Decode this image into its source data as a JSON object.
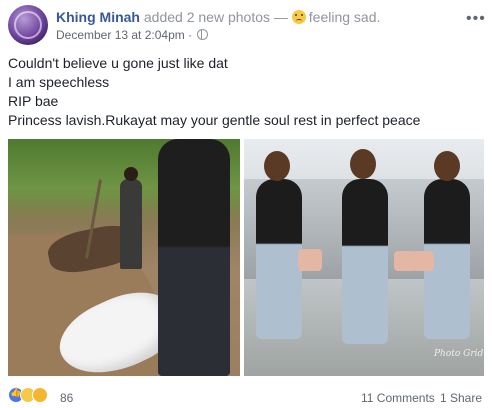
{
  "post": {
    "author": "Khing Minah",
    "action": "added 2 new photos —",
    "feeling": "feeling sad.",
    "timestamp": "December 13 at 2:04pm",
    "separator": "·",
    "more_icon": "ellipsis-icon",
    "privacy_icon": "globe-icon",
    "lines": [
      "Couldn't believe u gone just like dat",
      "I am speechless",
      "RIP bae",
      "Princess lavish.Rukayat may your gentle soul rest in perfect peace"
    ]
  },
  "photos": [
    {
      "name": "grave-photo"
    },
    {
      "name": "portrait-collage-photo",
      "watermark": "Photo Grid"
    }
  ],
  "footer": {
    "reaction_icons": [
      "like-icon",
      "sad-icon",
      "wow-icon"
    ],
    "reaction_count": "86",
    "comments": "11 Comments",
    "shares": "1 Share"
  },
  "colors": {
    "author": "#385898",
    "muted": "#90949c",
    "text": "#1d2129",
    "like": "#4b78e8",
    "emoji": "#f7c948"
  }
}
